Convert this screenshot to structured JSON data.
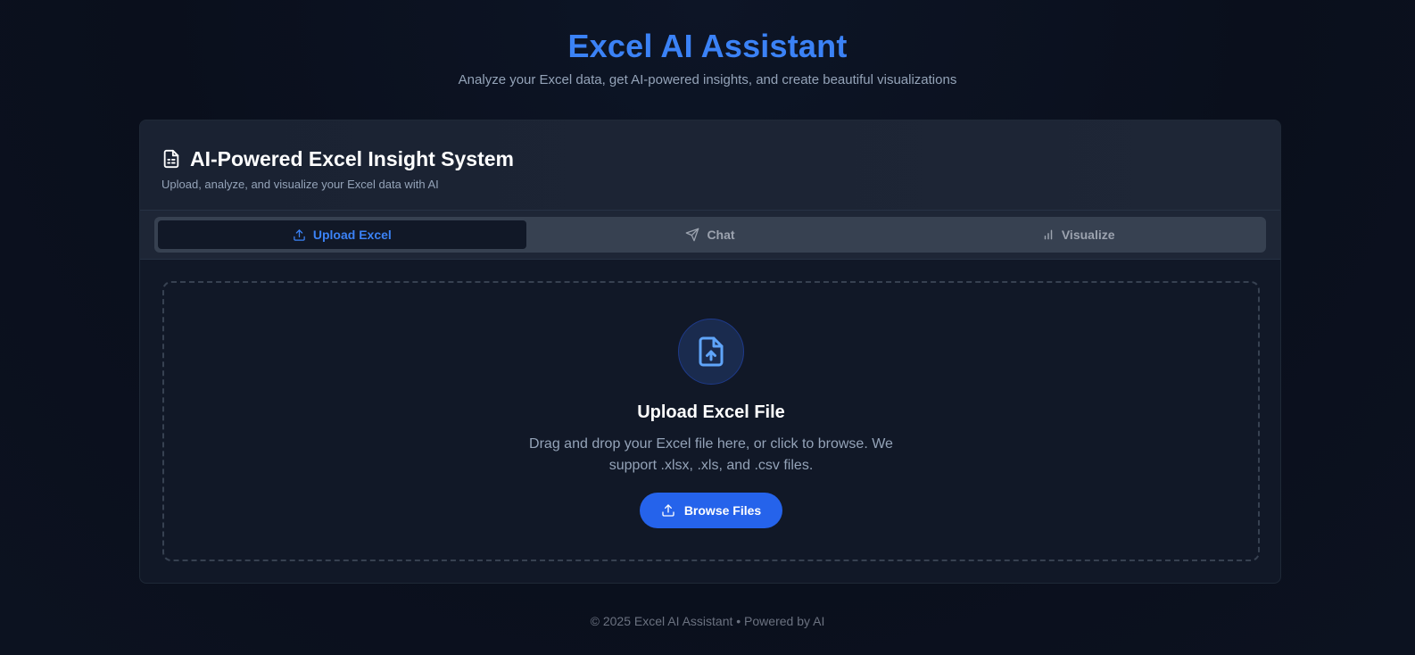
{
  "header": {
    "title": "Excel AI Assistant",
    "subtitle": "Analyze your Excel data, get AI-powered insights, and create beautiful visualizations"
  },
  "card": {
    "icon": "file-text-icon",
    "title": "AI-Powered Excel Insight System",
    "subtitle": "Upload, analyze, and visualize your Excel data with AI"
  },
  "tabs": [
    {
      "label": "Upload Excel",
      "icon": "upload-icon",
      "active": true
    },
    {
      "label": "Chat",
      "icon": "send-icon",
      "active": false
    },
    {
      "label": "Visualize",
      "icon": "bar-chart-icon",
      "active": false
    }
  ],
  "dropzone": {
    "icon": "file-upload-icon",
    "title": "Upload Excel File",
    "text": "Drag and drop your Excel file here, or click to browse. We support .xlsx, .xls, and .csv files.",
    "button_label": "Browse Files",
    "button_icon": "upload-icon"
  },
  "footer": {
    "text": "© 2025 Excel AI Assistant • Powered by AI"
  },
  "colors": {
    "accent": "#3b82f6",
    "button": "#2563eb",
    "background": "#0a0f1c"
  }
}
